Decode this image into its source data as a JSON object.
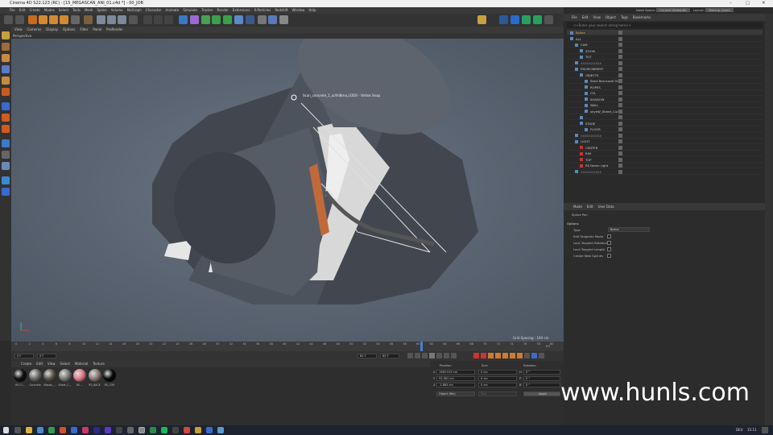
{
  "window": {
    "title": "Cinema 4D S22.123 (RC) - [15_MEGASCAN_ANI_01.c4d *] - 00_JOB"
  },
  "menu": [
    "File",
    "Edit",
    "Create",
    "Modes",
    "Select",
    "Tools",
    "Mesh",
    "Spline",
    "Volume",
    "MoGraph",
    "Character",
    "Animate",
    "Simulate",
    "Tracker",
    "Render",
    "Extensions",
    "X-Particles",
    "Redshift",
    "Window",
    "Help"
  ],
  "viewport": {
    "menu": [
      "View",
      "Cameras",
      "Display",
      "Options",
      "Filter",
      "Panel",
      "ProRender"
    ],
    "name": "Perspective",
    "snap_tooltip": "Scan_concrete_1_ucfmBrna_LOD0 - Vertex Snap",
    "grid_spacing": "Grid Spacing : 100 cm"
  },
  "timeline": {
    "ticks": [
      "0",
      "2",
      "4",
      "6",
      "8",
      "10",
      "12",
      "14",
      "16",
      "18",
      "20",
      "22",
      "24",
      "26",
      "28",
      "30",
      "32",
      "34",
      "36",
      "38",
      "40",
      "42",
      "44",
      "46",
      "48",
      "50",
      "52",
      "54",
      "56",
      "58",
      "60",
      "62",
      "64",
      "66",
      "68",
      "70",
      "72",
      "74",
      "76",
      "78",
      "80"
    ],
    "current": "0 F",
    "start": "0 F",
    "field2": "0 F",
    "end": "80 F",
    "end2": "80 F",
    "frame_readout": "0 F"
  },
  "materials": {
    "menu": [
      "Create",
      "Edit",
      "View",
      "Select",
      "Material",
      "Texture"
    ],
    "items": [
      "RS Ci...",
      "Concrete",
      "Mosaic_...",
      "Sheet_C...",
      "RS ...",
      "RS_BACK",
      "RS_COR"
    ]
  },
  "coords": {
    "headers": [
      "Position",
      "Size",
      "Rotation"
    ],
    "rows": [
      {
        "axis": "X",
        "pos": "1983.519 cm",
        "size": "0 cm",
        "rot_label": "H",
        "rot": "0 °"
      },
      {
        "axis": "Y",
        "pos": "92.961 cm",
        "size": "0 cm",
        "rot_label": "P",
        "rot": "0 °"
      },
      {
        "axis": "Z",
        "pos": "-1.883 cm",
        "size": "0 cm",
        "rot_label": "B",
        "rot": "0 °"
      }
    ],
    "mode": "Object (Rel)",
    "size_mode": "Size",
    "apply": "Apply"
  },
  "objects": {
    "menu": [
      "File",
      "Edit",
      "View",
      "Object",
      "Tags",
      "Bookmarks"
    ],
    "layout_label": "Node Space:",
    "layout_value": "Current (Redshift)",
    "layout2": "Layout:",
    "layout2_value": "Startup (User)",
    "search": "<<Enter your search string here>>",
    "rows": [
      {
        "name": "Spline",
        "indent": 2,
        "color": "#e8b84a"
      },
      {
        "name": "ALL",
        "indent": 2,
        "color": "#ccc"
      },
      {
        "name": "CAM",
        "indent": 8,
        "color": "#ccc"
      },
      {
        "name": "ZOOM",
        "indent": 14,
        "color": "#ccc"
      },
      {
        "name": "TILT",
        "indent": 14,
        "color": "#ccc"
      },
      {
        "name": "XXXXXXXXXX",
        "indent": 8,
        "color": "#888"
      },
      {
        "name": "ENVIRONMENT",
        "indent": 8,
        "color": "#ccc"
      },
      {
        "name": "OBJECTS",
        "indent": 14,
        "color": "#ccc"
      },
      {
        "name": "Steel Barricade 01",
        "indent": 20,
        "color": "#ccc"
      },
      {
        "name": "ROPES",
        "indent": 20,
        "color": "#ccc"
      },
      {
        "name": "CYL",
        "indent": 20,
        "color": "#ccc"
      },
      {
        "name": "SHADOW",
        "indent": 20,
        "color": "#ccc"
      },
      {
        "name": "WALL",
        "indent": 20,
        "color": "#ccc"
      },
      {
        "name": "xeyeW_Street_Curbs",
        "indent": 20,
        "color": "#ccc"
      },
      {
        "name": "-",
        "indent": 14,
        "color": "#888"
      },
      {
        "name": "STAGE",
        "indent": 14,
        "color": "#ccc"
      },
      {
        "name": "FLOOR",
        "indent": 20,
        "color": "#ccc"
      },
      {
        "name": "XXXXXXXXXX",
        "indent": 8,
        "color": "#888"
      },
      {
        "name": "LIGHT",
        "indent": 8,
        "color": "#ccc"
      },
      {
        "name": "CENTER",
        "indent": 14,
        "color": "#ccc"
      },
      {
        "name": "RIM",
        "indent": 14,
        "color": "#ccc"
      },
      {
        "name": "TOP",
        "indent": 14,
        "color": "#ccc"
      },
      {
        "name": "RS Dome Light",
        "indent": 14,
        "color": "#ccc"
      },
      {
        "name": "XXXXXXXXXX",
        "indent": 8,
        "color": "#888"
      }
    ]
  },
  "attributes": {
    "menu": [
      "Mode",
      "Edit",
      "User Data"
    ],
    "object": "Spline Pen",
    "section": "Options",
    "type_label": "Type",
    "type_value": "Bezier",
    "opts": [
      "Edit Tangents Mode",
      "Lock Tangent Rotation",
      "Lock Tangent Length",
      "Create New Splines"
    ]
  },
  "taskbar": {
    "lang": "DEU",
    "time": "15:11"
  },
  "watermark": "www.hunls.com"
}
